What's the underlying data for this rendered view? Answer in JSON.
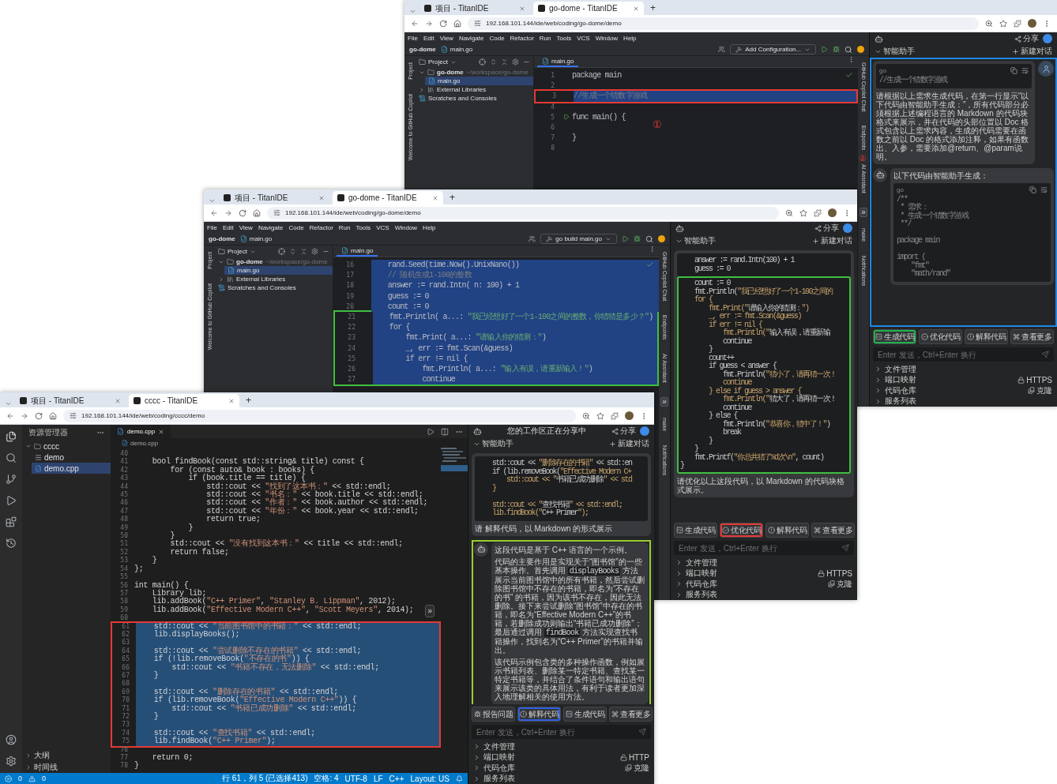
{
  "windows": [
    {
      "kind": "jetbrains",
      "browser": {
        "tabs": [
          {
            "title": "项目 - TitanIDE",
            "selected": false
          },
          {
            "title": "go-dome - TitanIDE",
            "selected": true
          }
        ],
        "new_tab": "+",
        "url": "192.168.101.144/ide/web/coding/go-dome/demo"
      },
      "ide": {
        "menu": [
          "File",
          "Edit",
          "View",
          "Navigate",
          "Code",
          "Refactor",
          "Run",
          "Tools",
          "VCS",
          "Window",
          "Help"
        ],
        "project_name": "go-dome",
        "file_name": "main.go",
        "run_config": "Add Configuration...",
        "left_strip": [
          {
            "kind": "label",
            "label": "Project"
          },
          {
            "kind": "label",
            "label": "Welcome to GitHub Copilot"
          }
        ],
        "project_panel": {
          "title": "Project",
          "tree": [
            {
              "label": "go-dome",
              "hint": "~/workspace/go-dome",
              "kind": "folder",
              "expanded": true,
              "selected": false,
              "children": [
                {
                  "label": "main.go",
                  "kind": "file",
                  "selected": true
                }
              ]
            },
            {
              "label": "External Libraries",
              "kind": "library",
              "expanded": false,
              "selected": false
            },
            {
              "label": "Scratches and Consoles",
              "kind": "scratch",
              "selected": false
            }
          ]
        },
        "editor": {
          "tab": "main.go",
          "annotation": "①",
          "line_groups": [
            {
              "lines": [
                {
                  "number": "1",
                  "code": "package main",
                  "selected": false,
                  "run_marker": false
                },
                {
                  "number": "2",
                  "selected": false,
                  "run_marker": false
                }
              ]
            },
            {
              "frame": {
                "color": "#e53935"
              },
              "lines": [
                {
                  "number": "3",
                  "code": "//生成一个猜数字游戏",
                  "selected": true,
                  "run_marker": false
                }
              ]
            },
            {
              "lines": [
                {
                  "number": "4",
                  "selected": false,
                  "run_marker": false
                },
                {
                  "number": "5",
                  "code": "func main() {",
                  "selected": false,
                  "run_marker": true
                },
                {
                  "number": "6",
                  "selected": false,
                  "run_marker": false
                },
                {
                  "number": "7",
                  "code": "}",
                  "selected": false,
                  "run_marker": false
                },
                {
                  "number": "8",
                  "selected": false,
                  "run_marker": false
                }
              ]
            }
          ]
        },
        "right_strip": [
          {
            "kind": "label",
            "label": "GitHub Copilot Chat"
          },
          {
            "kind": "label",
            "label": "Endpoints"
          },
          {
            "kind": "label",
            "label": "AI Assistant",
            "annotation": "②"
          },
          {
            "kind": "toggle",
            "glyph": "»"
          },
          {
            "kind": "label",
            "label": "make"
          },
          {
            "kind": "label",
            "label": "Notifications"
          }
        ]
      },
      "assistant": {
        "share": "分享",
        "section": "智能助手",
        "new_chat": "新建对话",
        "messages_frame": {
          "color": "#1e88e5"
        },
        "messages": [
          {
            "kind": "user",
            "show_avatar": true,
            "blocks": [
              {
                "kind": "code",
                "lang": "go",
                "code": "//生成一个猜数字游戏"
              },
              {
                "kind": "text",
                "text": "请根据以上需求生成代码，在第一行显示“以下代码由智能助手生成：”，所有代码部分必须根据上述编程语言的 Markdown 的代码块格式来展示，并在代码的头部位置以 Doc 格式包含以上需求内容，生成的代码需要在函数之前以 Doc 的格式添加注释，如果有函数出、入参，需要添加@return、@param说明。"
              }
            ]
          },
          {
            "kind": "assistant",
            "show_avatar": true,
            "blocks": [
              {
                "kind": "text",
                "text": "以下代码由智能助手生成："
              },
              {
                "kind": "code",
                "lang": "go",
                "code": "/**\n * 需求：\n * 生成一个猜数字游戏\n **/\n\npackage main\n\nimport (\n    \"fmt\"\n    \"math/rand\""
              }
            ]
          }
        ],
        "actions": [
          {
            "label": "生成代码",
            "kind": "generate",
            "frame": {
              "color": "#22b14c"
            }
          },
          {
            "label": "优化代码",
            "kind": "optimize"
          },
          {
            "label": "解释代码",
            "kind": "explain"
          },
          {
            "label": "查看更多",
            "kind": "more"
          }
        ],
        "input_placeholder": "Enter 发送，Ctrl+Enter 换行",
        "sections": [
          {
            "label": "文件管理"
          },
          {
            "label": "端口映射",
            "extra": {
              "kind": "lock",
              "text": "HTTPS"
            }
          },
          {
            "label": "代码仓库",
            "extra": {
              "kind": "clone",
              "text": "克隆"
            }
          },
          {
            "label": "服务列表"
          }
        ]
      }
    },
    {
      "kind": "jetbrains",
      "browser": {
        "tabs": [
          {
            "title": "项目 - TitanIDE",
            "selected": false
          },
          {
            "title": "go-dome - TitanIDE",
            "selected": true
          }
        ],
        "new_tab": "+",
        "url": "192.168.101.144/ide/web/coding/go-dome/demo"
      },
      "ide": {
        "menu": [
          "File",
          "Edit",
          "View",
          "Navigate",
          "Code",
          "Refactor",
          "Run",
          "Tools",
          "VCS",
          "Window",
          "Help"
        ],
        "project_name": "go-dome",
        "file_name": "main.go",
        "run_config": "go build main.go",
        "left_strip": [
          {
            "kind": "label",
            "label": "Project"
          },
          {
            "kind": "label",
            "label": "Welcome to GitHub Copilot"
          }
        ],
        "project_panel": {
          "title": "Project",
          "tree": [
            {
              "label": "go-dome",
              "hint": "~/workspace/go-dome",
              "kind": "folder",
              "expanded": true,
              "selected": false,
              "children": [
                {
                  "label": "main.go",
                  "kind": "file",
                  "selected": true
                }
              ]
            },
            {
              "label": "External Libraries",
              "kind": "library",
              "expanded": false,
              "selected": false
            },
            {
              "label": "Scratches and Consoles",
              "kind": "scratch",
              "selected": false
            }
          ]
        },
        "editor": {
          "tab": "main.go",
          "line_groups": [
            {
              "lines": [
                {
                  "number": "16",
                  "code": "    rand.Seed(time.Now().UnixNano())",
                  "selected": true
                },
                {
                  "number": "17",
                  "code": "    // 随机生成1-100的整数",
                  "selected": true
                },
                {
                  "number": "18",
                  "code": "    answer := rand.Intn( n: 100) + 1",
                  "selected": true
                },
                {
                  "number": "19",
                  "code": "    guess := 0",
                  "selected": true
                },
                {
                  "number": "20",
                  "code": "    count := 0",
                  "selected": true
                }
              ]
            },
            {
              "frame": {
                "color": "#3fbf3f"
              },
              "lines": [
                {
                  "number": "21",
                  "code": "    fmt.Println( a...: \"我已经想好了一个1-100之间的整数，你猜猜是多少？\")",
                  "selected": true
                },
                {
                  "number": "22",
                  "code": "    for {",
                  "selected": true
                },
                {
                  "number": "23",
                  "code": "        fmt.Print( a...: \"请输入你的猜测：\")",
                  "selected": true
                },
                {
                  "number": "24",
                  "code": "        _, err := fmt.Scan(&guess)",
                  "selected": true
                },
                {
                  "number": "25",
                  "code": "        if err != nil {",
                  "selected": true
                },
                {
                  "number": "26",
                  "code": "            fmt.Println( a...: \"输入有误，请重新输入！\")",
                  "selected": true
                },
                {
                  "number": "27",
                  "code": "            continue",
                  "selected": true
                }
              ]
            }
          ]
        },
        "right_strip": [
          {
            "kind": "label",
            "label": "GitHub Copilot Chat"
          },
          {
            "kind": "label",
            "label": "Endpoints"
          },
          {
            "kind": "label",
            "label": "AI Assistant"
          },
          {
            "kind": "toggle",
            "glyph": "»"
          },
          {
            "kind": "label",
            "label": "make"
          },
          {
            "kind": "label",
            "label": "Notifications"
          }
        ]
      },
      "assistant": {
        "share": "分享",
        "section": "智能助手",
        "new_chat": "新建对话",
        "messages": [
          {
            "kind": "user",
            "show_avatar": false,
            "blocks": [
              {
                "kind": "code",
                "code": "    answer := rand.Intn(100) + 1\n    guess := 0"
              },
              {
                "kind": "code",
                "frame": {
                  "color": "#3fbf3f"
                },
                "code": "    count := 0\n    fmt.Println(\"我已经想好了一个1-100之间的\n    for {\n        fmt.Print(\"请输入你的猜测：\")\n        _, err := fmt.Scan(&guess)\n        if err != nil {\n            fmt.Println(\"输入有误，请重新输\n            continue\n        }\n        count++\n        if guess < answer {\n            fmt.Println(\"猜小了，请再猜一次！\n            continue\n        } else if guess > answer {\n            fmt.Println(\"猜大了，请再猜一次！\n            continue\n        } else {\n            fmt.Println(\"恭喜你，猜中了！\")\n            break\n        }\n    }\n    fmt.Printf(\"你总共猜了%d次\\n\", count)\n}"
              },
              {
                "kind": "text",
                "text": "请优化以上这段代码，以 Markdown 的代码块格式展示。"
              }
            ]
          }
        ],
        "actions": [
          {
            "label": "生成代码",
            "kind": "generate"
          },
          {
            "label": "优化代码",
            "kind": "optimize",
            "frame": {
              "color": "#e53935"
            }
          },
          {
            "label": "解释代码",
            "kind": "explain"
          },
          {
            "label": "查看更多",
            "kind": "more"
          }
        ],
        "input_placeholder": "Enter 发送，Ctrl+Enter 换行",
        "sections": [
          {
            "label": "文件管理"
          },
          {
            "label": "端口映射",
            "extra": {
              "kind": "lock",
              "text": "HTTPS"
            }
          },
          {
            "label": "代码仓库",
            "extra": {
              "kind": "clone",
              "text": "克隆"
            }
          },
          {
            "label": "服务列表"
          }
        ]
      }
    },
    {
      "kind": "vscode",
      "browser": {
        "tabs": [
          {
            "title": "项目 - TitanIDE",
            "selected": false
          },
          {
            "title": "cccc - TitanIDE",
            "selected": true
          }
        ],
        "new_tab": "+",
        "url": "192.168.101.144/ide/web/coding/cccc/demo"
      },
      "ide": {
        "sidebar": {
          "title": "资源管理器",
          "tree": [
            {
              "label": "cccc",
              "kind": "folder",
              "expanded": true,
              "selected": false,
              "children": [
                {
                  "label": "demo",
                  "kind": "make",
                  "selected": false
                },
                {
                  "label": "demo.cpp",
                  "kind": "cpp",
                  "selected": true
                }
              ]
            }
          ],
          "sections": [
            {
              "label": "大纲",
              "expanded": false
            },
            {
              "label": "时间线",
              "expanded": false
            }
          ]
        },
        "editor": {
          "tab": "demo.cpp",
          "breadcrumb": "demo.cpp",
          "line_groups": [
            {
              "lines": [
                {
                  "number": "40",
                  "selected": false
                },
                {
                  "number": "41",
                  "code": "    bool findBook(const std::string& title) const {",
                  "selected": false
                },
                {
                  "number": "42",
                  "code": "        for (const auto& book : books) {",
                  "selected": false
                },
                {
                  "number": "43",
                  "code": "            if (book.title == title) {",
                  "selected": false
                },
                {
                  "number": "44",
                  "code": "                std::cout << \"找到了这本书：\" << std::endl;",
                  "selected": false
                },
                {
                  "number": "45",
                  "code": "                std::cout << \"书名：\" << book.title << std::endl;",
                  "selected": false
                },
                {
                  "number": "46",
                  "code": "                std::cout << \"作者：\" << book.author << std::endl;",
                  "selected": false
                },
                {
                  "number": "47",
                  "code": "                std::cout << \"年份：\" << book.year << std::endl;",
                  "selected": false
                },
                {
                  "number": "48",
                  "code": "                return true;",
                  "selected": false
                },
                {
                  "number": "49",
                  "code": "            }",
                  "selected": false
                },
                {
                  "number": "50",
                  "code": "        }",
                  "selected": false
                },
                {
                  "number": "51",
                  "code": "        std::cout << \"没有找到这本书：\" << title << std::endl;",
                  "selected": false
                },
                {
                  "number": "52",
                  "code": "        return false;",
                  "selected": false
                },
                {
                  "number": "53",
                  "code": "    }",
                  "selected": false
                },
                {
                  "number": "54",
                  "code": "};",
                  "selected": false
                },
                {
                  "number": "55",
                  "selected": false
                },
                {
                  "number": "56",
                  "code": "int main() {",
                  "selected": false
                },
                {
                  "number": "57",
                  "code": "    Library lib;",
                  "selected": false
                },
                {
                  "number": "58",
                  "code": "    lib.addBook(\"C++ Primer\", \"Stanley B. Lippman\", 2012);",
                  "selected": false
                },
                {
                  "number": "59",
                  "code": "    lib.addBook(\"Effective Modern C++\", \"Scott Meyers\", 2014);",
                  "selected": false
                },
                {
                  "number": "60",
                  "selected": false
                }
              ]
            },
            {
              "frame": {
                "color": "#e53935"
              },
              "lines": [
                {
                  "number": "61",
                  "code": "    std::cout << \"当前图书馆中的书籍：\" << std::endl;",
                  "selected": true
                },
                {
                  "number": "62",
                  "code": "    lib.displayBooks();",
                  "selected": true
                },
                {
                  "number": "63",
                  "selected": true
                },
                {
                  "number": "64",
                  "code": "    std::cout << \"尝试删除不存在的书籍\" << std::endl;",
                  "selected": true
                },
                {
                  "number": "65",
                  "code": "    if (!lib.removeBook(\"不存在的书\")) {",
                  "selected": true
                },
                {
                  "number": "66",
                  "code": "        std::cout << \"书籍不存在，无法删除\" << std::endl;",
                  "selected": true
                },
                {
                  "number": "67",
                  "code": "    }",
                  "selected": true
                },
                {
                  "number": "68",
                  "selected": true
                },
                {
                  "number": "69",
                  "code": "    std::cout << \"删除存在的书籍\" << std::endl;",
                  "selected": true
                },
                {
                  "number": "70",
                  "code": "    if (lib.removeBook(\"Effective Modern C++\")) {",
                  "selected": true
                },
                {
                  "number": "71",
                  "code": "        std::cout << \"书籍已成功删除\" << std::endl;",
                  "selected": true
                },
                {
                  "number": "72",
                  "code": "    }",
                  "selected": true
                },
                {
                  "number": "73",
                  "selected": true
                },
                {
                  "number": "74",
                  "code": "    std::cout << \"查找书籍\" << std::endl;",
                  "selected": true
                },
                {
                  "number": "75",
                  "code": "    lib.findBook(\"C++ Primer\");",
                  "selected": true
                }
              ]
            },
            {
              "lines": [
                {
                  "number": "76",
                  "selected": false
                },
                {
                  "number": "77",
                  "code": "    return 0;",
                  "selected": false
                },
                {
                  "number": "78",
                  "code": "}",
                  "selected": false
                }
              ]
            }
          ]
        },
        "collapse_toggle": "»",
        "status_bar": {
          "errors": "0",
          "warnings": "0",
          "items": [
            "行 61，列 5 (已选择413)",
            "空格: 4",
            "UTF-8",
            "LF",
            "C++",
            "Layout: US"
          ]
        }
      },
      "assistant": {
        "title": "您的工作区正在分享中",
        "share": "分享",
        "section": "智能助手",
        "new_chat": "新建对话",
        "messages": [
          {
            "kind": "user",
            "show_avatar": false,
            "blocks": [
              {
                "kind": "code",
                "code": "    std::cout << \"删除存在的书籍\" << std::en\n    if (lib.removeBook(\"Effective Modern C+\n        std::cout << \"书籍已成功删除\" << std\n    }\n\n    std::cout << \"查找书籍\" << std::endl;\n    lib.findBook(\"C++ Primer\");"
              },
              {
                "kind": "text",
                "text": "请 解释代码，以 Markdown 的形式展示"
              }
            ]
          },
          {
            "kind": "assistant",
            "show_avatar": true,
            "frame": {
              "color": "#9acd32"
            },
            "blocks": [
              {
                "kind": "paragraphs",
                "paragraphs": [
                  [
                    {
                      "text": "这段代码是基于 C++ 语言的一个示例。",
                      "code": false
                    }
                  ],
                  [
                    {
                      "text": "代码的主要作用是实现关于“图书馆”的一些基本操作。首先调用 ",
                      "code": false
                    },
                    {
                      "text": "displayBooks",
                      "code": true
                    },
                    {
                      "text": " 方法展示当前图书馆中的所有书籍，然后尝试删除图书馆中不存在的书籍，即名为“不存在的书” 的书籍，因为该书不存在，因此无法删除。接下来尝试删除“图书馆”中存在的书籍，即名为“Effective Modern C++”的书籍，若删除成功则输出“书籍已成功删除”；最后通过调用 ",
                      "code": false
                    },
                    {
                      "text": "findBook",
                      "code": true
                    },
                    {
                      "text": " 方法实现查找书籍操作，找到名为“C++ Primer”的书籍并输出。",
                      "code": false
                    }
                  ],
                  [
                    {
                      "text": "该代码示例包含类的多种操作函数，例如展示书籍列表、删除某一特定书籍、查找某一特定书籍等，并结合了条件语句和输出语句来展示该类的具体用法，有利于读者更加深入地理解相关的使用方法。",
                      "code": false
                    }
                  ]
                ]
              }
            ]
          }
        ],
        "actions": [
          {
            "label": "报告问题",
            "kind": "report"
          },
          {
            "label": "解释代码",
            "kind": "explain",
            "frame": {
              "color": "#2f5fe0"
            }
          },
          {
            "label": "生成代码",
            "kind": "generate"
          },
          {
            "label": "查看更多",
            "kind": "more"
          }
        ],
        "input_placeholder": "Enter 发送，Ctrl+Enter 换行",
        "sections": [
          {
            "label": "文件管理"
          },
          {
            "label": "端口映射",
            "extra": {
              "kind": "unlock",
              "text": "HTTP"
            }
          },
          {
            "label": "代码仓库",
            "extra": {
              "kind": "clone",
              "text": "克隆"
            }
          },
          {
            "label": "服务列表"
          }
        ]
      }
    }
  ]
}
